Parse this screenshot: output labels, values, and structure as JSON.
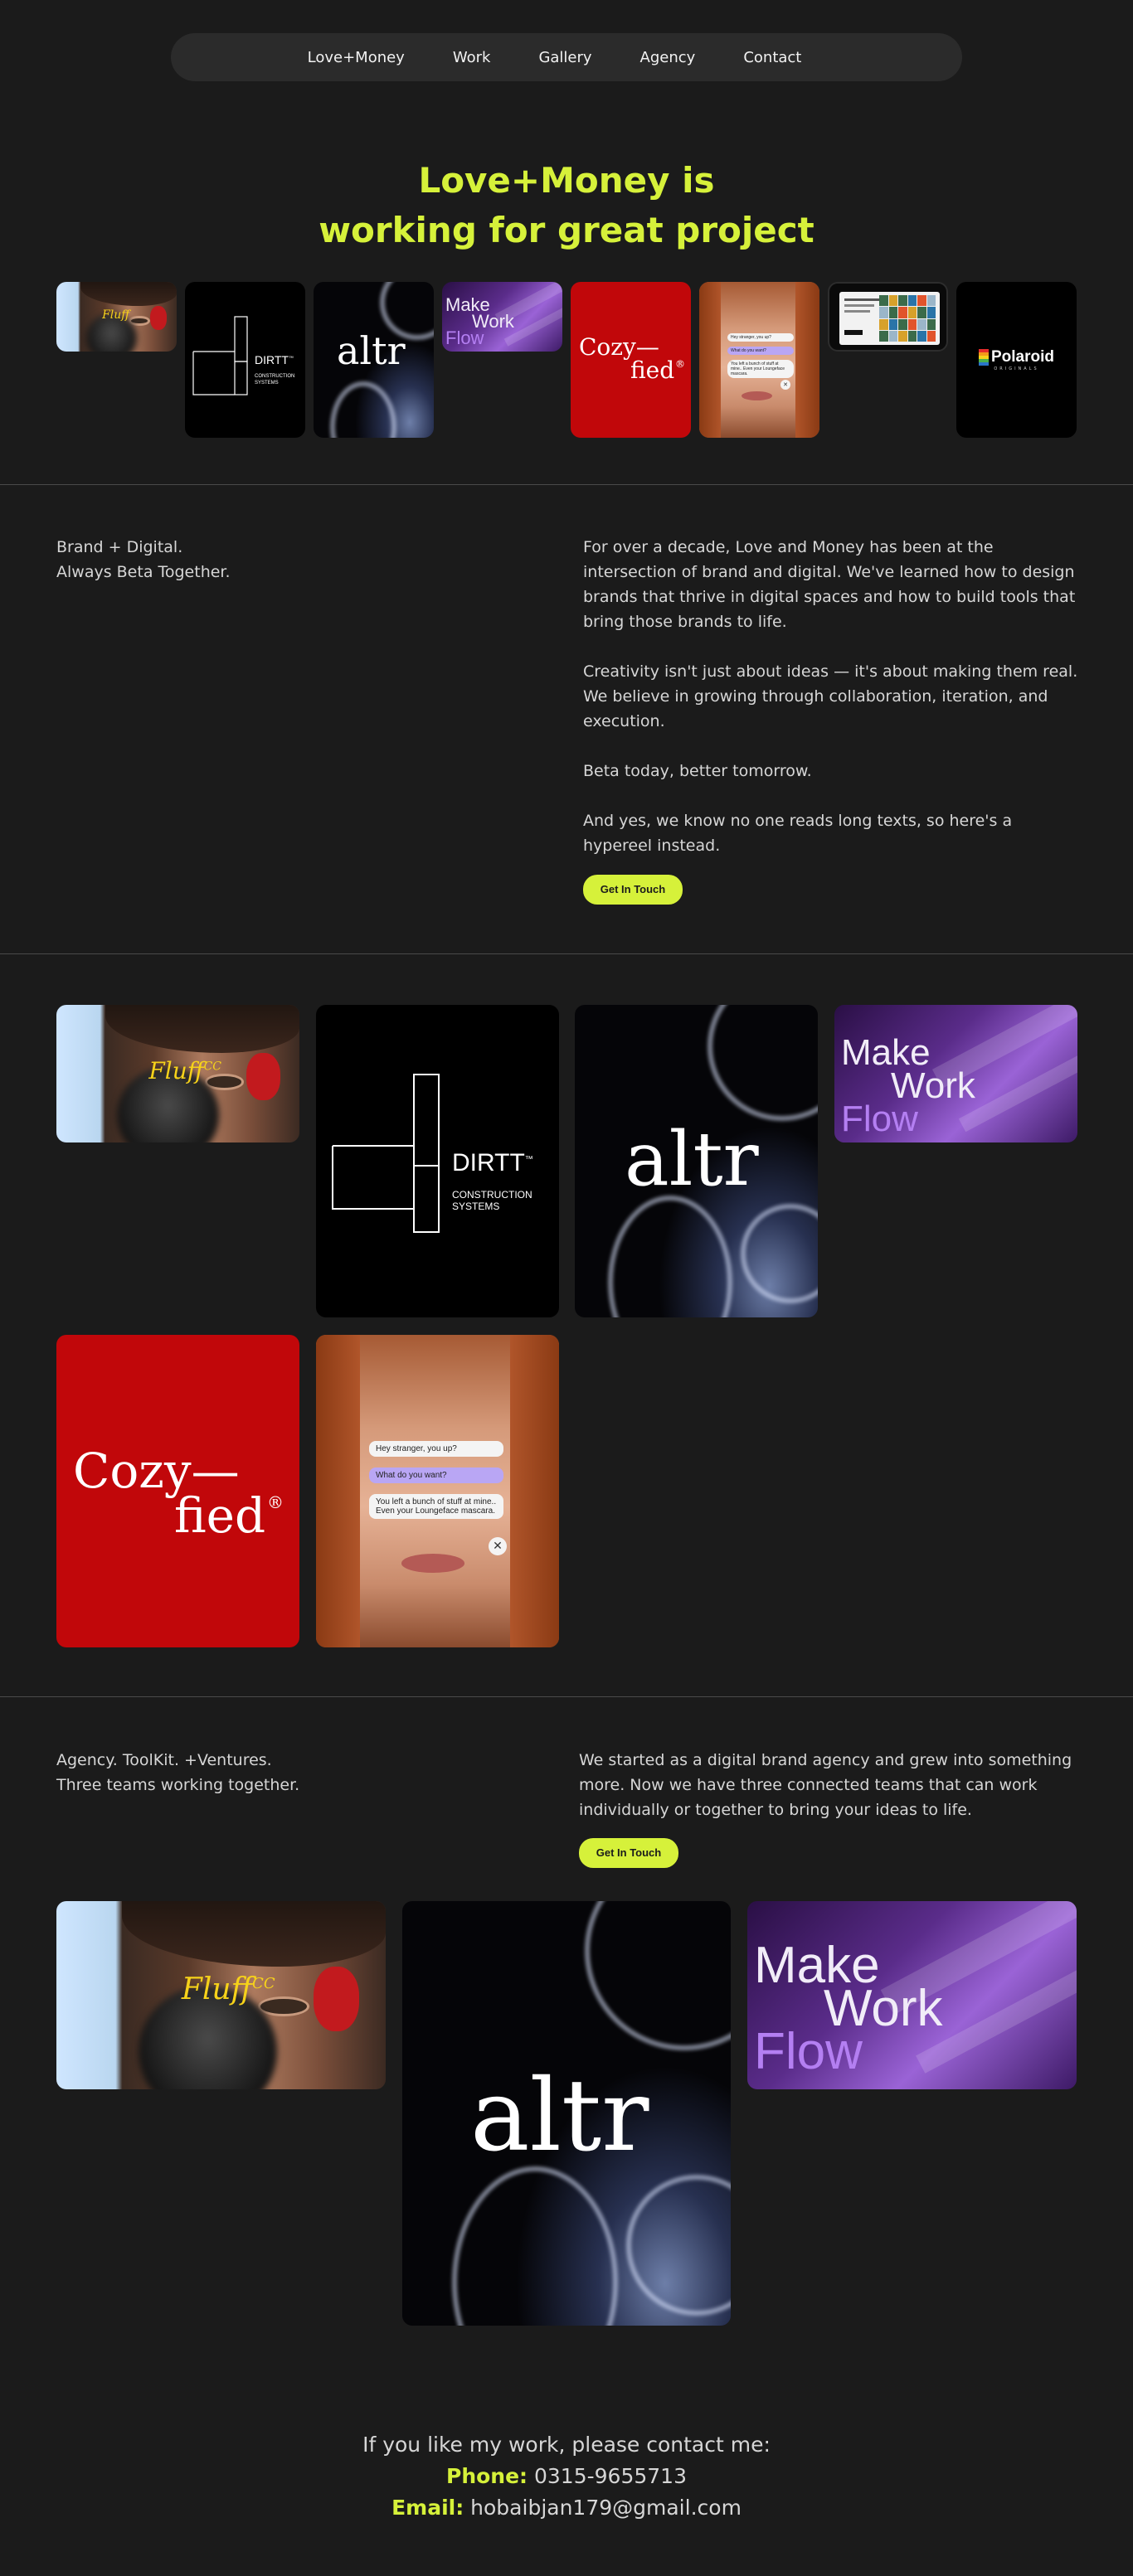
{
  "nav": {
    "items": [
      "Love+Money",
      "Work",
      "Gallery",
      "Agency",
      "Contact"
    ]
  },
  "hero": {
    "title_line1": "Love+Money is",
    "title_line2": "working for great project"
  },
  "projects": {
    "fluff": "Fluff",
    "fluff_sup": "CC",
    "dirtt_name": "DIRTT",
    "dirtt_tm": "™",
    "dirtt_sub1": "CONSTRUCTION",
    "dirtt_sub2": "SYSTEMS",
    "altr": "altr",
    "make": "Make",
    "work": "Work",
    "flow": "Flow",
    "cozy1": "Cozy—",
    "cozy2": "fied",
    "cozy_mark": "®",
    "chat1": "Hey stranger, you up?",
    "chat2": "What do you want?",
    "chat3": "You left a bunch of stuff at mine.. Even your Loungeface mascara.",
    "chat_close": "✕",
    "polaroid": "Polaroid",
    "polaroid_sub": "ORIGINALS"
  },
  "about": {
    "tagline1": "Brand + Digital.",
    "tagline2": "Always Beta Together.",
    "p1": "For over a decade, Love and Money has been at the intersection of brand and digital. We've learned how to design brands that thrive in digital spaces and how to build tools that bring those brands to life.",
    "p2": "Creativity isn't just about ideas — it's about making them real. We believe in growing through collaboration, iteration, and execution.",
    "p3": "Beta today, better tomorrow.",
    "p4": "And yes, we know no one reads long texts, so here's a hypereel instead.",
    "cta": "Get In Touch"
  },
  "agency": {
    "tagline1": "Agency. ToolKit. +Ventures.",
    "tagline2": "Three teams working together.",
    "p1": "We started as a digital brand agency and grew into something more. Now we have three connected teams that can work individually or together to bring your ideas to life.",
    "cta": "Get In Touch"
  },
  "contact": {
    "intro": "If you like my work, please contact me:",
    "phone_label": "Phone:",
    "phone": "0315-9655713",
    "email_label": "Email:",
    "email": "hobaibjan179@gmail.com"
  },
  "colors": {
    "accent": "#d6f13a",
    "background": "#1b1b1b",
    "cozy_red": "#c1070a"
  }
}
